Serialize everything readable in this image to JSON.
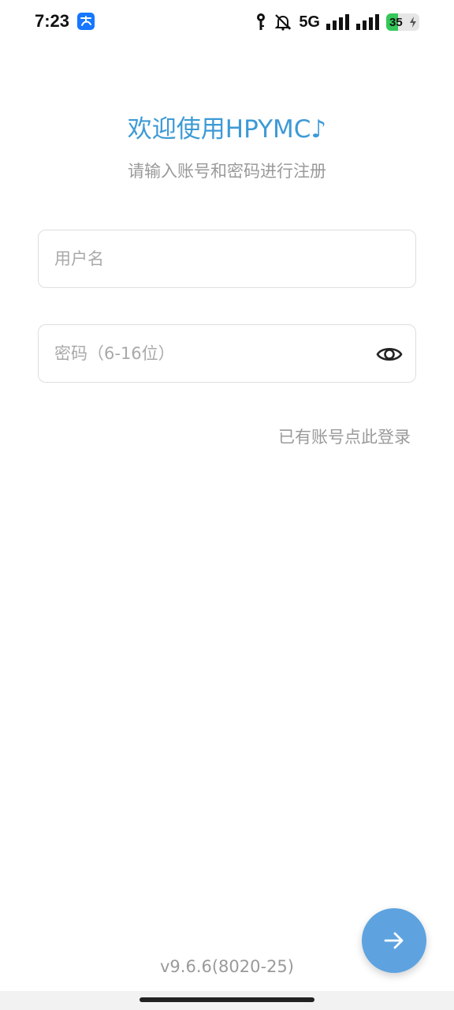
{
  "status_bar": {
    "time": "7:23",
    "network": "5G",
    "battery_level": "35",
    "battery_fraction": 0.35,
    "icons": [
      "alipay-icon",
      "key-icon",
      "bell-off-icon",
      "signal-icon",
      "signal-icon-2",
      "battery-icon"
    ]
  },
  "header": {
    "title": "欢迎使用HPYMC♪",
    "subtitle": "请输入账号和密码进行注册"
  },
  "form": {
    "username_placeholder": "用户名",
    "username_value": "",
    "password_placeholder": "密码（6-16位）",
    "password_value": ""
  },
  "login_link": "已有账号点此登录",
  "version": "v9.6.6(8020-25)",
  "colors": {
    "accent": "#3d9ad6",
    "fab": "#5ea3e0",
    "muted_text": "#9a9a9a",
    "border": "#dedede",
    "battery": "#34c759"
  }
}
